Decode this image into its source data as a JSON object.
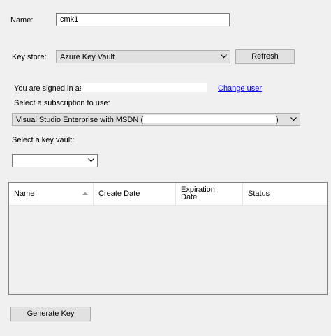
{
  "form": {
    "name_label": "Name:",
    "name_value": "cmk1",
    "key_store_label": "Key store:",
    "key_store_value": "Azure Key Vault",
    "refresh_label": "Refresh",
    "signed_in_label": "You are signed in as",
    "change_user_label": "Change user",
    "subscription_prompt": "Select a subscription to use:",
    "subscription_prefix": "Visual Studio Enterprise with MSDN (",
    "subscription_suffix": ")",
    "key_vault_prompt": "Select a key vault:",
    "generate_key_label": "Generate Key"
  },
  "table": {
    "columns": [
      "Name",
      "Create Date",
      "Expiration Date",
      "Status"
    ],
    "sorted_column": "Name",
    "rows": []
  },
  "icons": {
    "dropdown": "chevron-down-icon",
    "sort": "sort-up-icon"
  }
}
